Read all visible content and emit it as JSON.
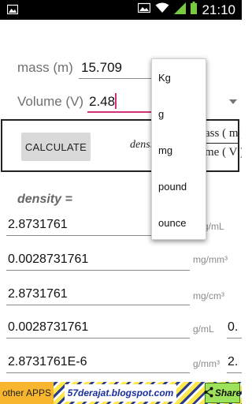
{
  "status_bar": {
    "time": "21:10"
  },
  "inputs": {
    "mass_label": "mass (m)",
    "mass_value": "15.709",
    "volume_label": "Volume (V)",
    "volume_value": "2.48"
  },
  "calculate": {
    "button_label": "CALCULATE",
    "formula_left": "densi",
    "formula_numerator": "ass ( m )",
    "formula_denominator": "me ( V )"
  },
  "results": {
    "label": "density  =",
    "rows": [
      {
        "value": "2.8731761",
        "unit": "g/mL"
      },
      {
        "value": "0.0028731761",
        "unit": "mg/mm³"
      },
      {
        "value": "2.8731761",
        "unit": "mg/cm³"
      },
      {
        "value": "0.0028731761",
        "unit": "g/mL"
      },
      {
        "value": "2.8731761E-6",
        "unit": "g/mm³"
      }
    ],
    "partial_values": [
      "0.",
      "2."
    ]
  },
  "dropdown": {
    "options": [
      "Kg",
      "g",
      "mg",
      "pound",
      "ounce"
    ]
  },
  "footer": {
    "other_apps": "other APPS",
    "blog": "57derajat.blogspot.com",
    "share": "Share"
  },
  "colors": {
    "accent": "#d6317a",
    "share_green": "#9de25a",
    "other_apps_orange": "#f7b62e",
    "blog_blue": "#1a2f9c"
  }
}
